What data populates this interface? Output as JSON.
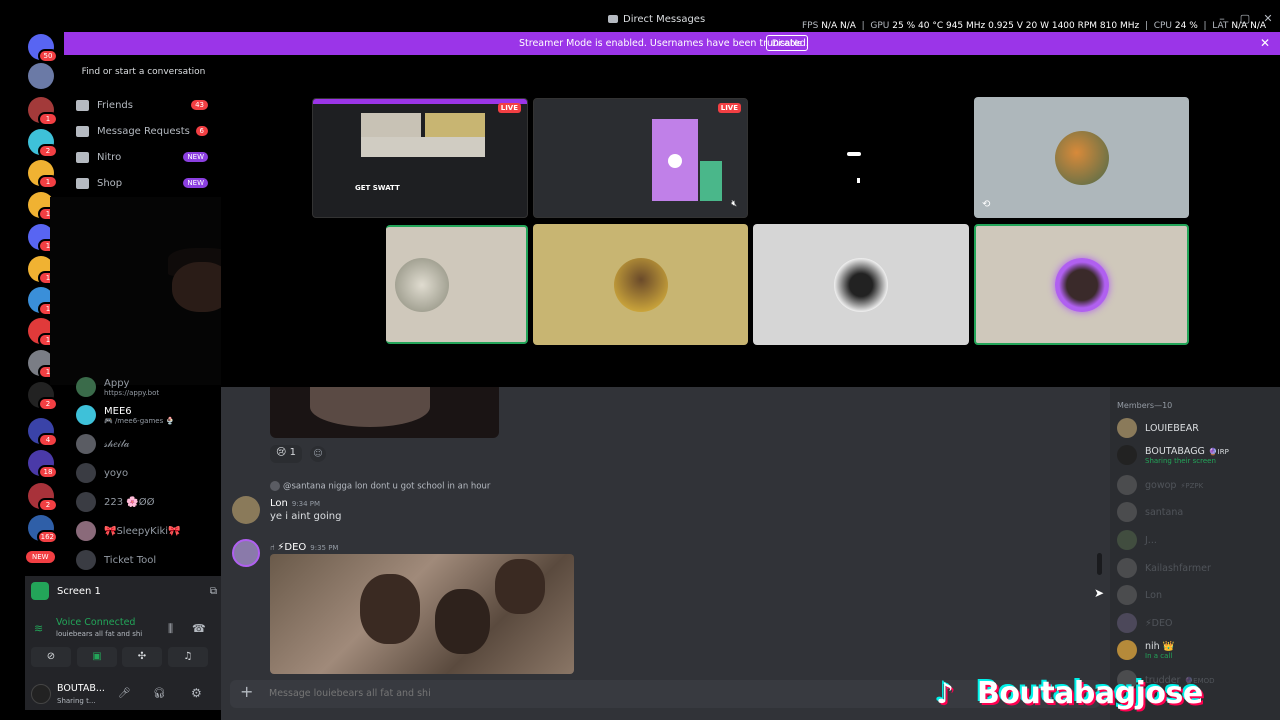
{
  "window": {
    "title": "Direct Messages",
    "stats": {
      "fps_label": "FPS",
      "fps_value": "N/A",
      "fps_value2": "N/A",
      "gpu_label": "GPU",
      "gpu_value": "25 % 40 °C 945 MHz 0.925 V 20 W 1400 RPM 810 MHz",
      "cpu_label": "CPU",
      "cpu_value": "24 %",
      "lat_label": "LAT",
      "lat_value": "N/A",
      "lat_value2": "N/A"
    }
  },
  "banner": {
    "text": "Streamer Mode is enabled. Usernames have been truncated.",
    "button": "Disable",
    "close": "✕"
  },
  "servers": [
    {
      "badge": "50",
      "color": "#5865f2"
    },
    {
      "badge": "",
      "color": "#6b7aa6"
    },
    {
      "badge": "1",
      "color": "#a33a3a"
    },
    {
      "badge": "2",
      "color": "#3ec1d9"
    },
    {
      "badge": "1",
      "color": "#f0b232"
    },
    {
      "badge": "1",
      "color": "#f0b232"
    },
    {
      "badge": "1",
      "color": "#5865f2"
    },
    {
      "badge": "1",
      "color": "#f0b232"
    },
    {
      "badge": "1",
      "color": "#3a8fd9"
    },
    {
      "badge": "1",
      "color": "#e03a3a"
    },
    {
      "badge": "1",
      "color": "#7a7d85"
    },
    {
      "badge": "2",
      "color": "#222222"
    },
    {
      "badge": "4",
      "color": "#3a43a8"
    },
    {
      "badge": "18",
      "color": "#4a3aa8"
    },
    {
      "badge": "2",
      "color": "#a8323a"
    },
    {
      "badge": "162",
      "color": "#2f5fa8"
    }
  ],
  "new_pill": "NEW",
  "sidebar": {
    "find": "Find or start a conversation",
    "nav": [
      {
        "label": "Friends",
        "pill": "43"
      },
      {
        "label": "Message Requests",
        "pill": "6"
      },
      {
        "label": "Nitro",
        "pill": "NEW"
      },
      {
        "label": "Shop",
        "pill": "NEW"
      }
    ],
    "dms": [
      {
        "name": "Appy",
        "sub": "https://appy.bot",
        "color": "#3a6b4a"
      },
      {
        "name": "MEE6",
        "sub": "🎮 /mee6-games 🍨",
        "color": "#3ec1d9"
      },
      {
        "name": "𝓈𝒽𝑒𝒾𝓁𝒶",
        "sub": "",
        "color": "#5a5c63"
      },
      {
        "name": "yoyo",
        "sub": "",
        "color": "#4a4c53"
      },
      {
        "name": "223 🌸ØØ",
        "sub": "",
        "color": "#4a4c53"
      },
      {
        "name": "🎀SleepyKiki🎀",
        "sub": "",
        "color": "#8a6a7a"
      },
      {
        "name": "Ticket Tool",
        "sub": "",
        "color": "#3a3c43"
      }
    ]
  },
  "voice": {
    "screen_label": "Screen 1",
    "status": "Voice Connected",
    "channel": "louiebears all fat and shi",
    "user": "BOUTAB...",
    "user_status": "Sharing t..."
  },
  "stage": {
    "live": "LIVE",
    "stream_caption": "GET SWATT",
    "tiles_row2_colors": [
      "#cfc8bb",
      "#c8b572",
      "#d6d6d6",
      "#cfc8bb"
    ],
    "top_right_color": "#aeb7bb"
  },
  "chat": {
    "reaction_count": "1",
    "reply_ref": "@santana nigga lon dont u got school in an hour",
    "messages": [
      {
        "author": "Lon",
        "time": "9:34 PM",
        "text": "ye i aint going"
      },
      {
        "author": "⚡DEO",
        "time": "9:35 PM",
        "text": ""
      }
    ],
    "placeholder": "Message louiebears all fat and shi"
  },
  "members": {
    "header": "Members—10",
    "list": [
      {
        "name": "LOUIEBEAR",
        "status": "",
        "dim": false,
        "color": "#8a7a5a"
      },
      {
        "name": "BOUTABAGG",
        "tag": "🔮IRP",
        "status": "Sharing their screen",
        "dim": false,
        "color": "#222"
      },
      {
        "name": "gowop",
        "tag": "⚡PZPK",
        "status": "",
        "dim": true,
        "color": "#888"
      },
      {
        "name": "santana",
        "status": "",
        "dim": true,
        "color": "#888"
      },
      {
        "name": "J...",
        "status": "",
        "dim": true,
        "color": "#6a8a5a"
      },
      {
        "name": "Kailashfarmer",
        "status": "",
        "dim": true,
        "color": "#888"
      },
      {
        "name": "Lon",
        "status": "",
        "dim": true,
        "color": "#888"
      },
      {
        "name": "⚡DEO",
        "status": "",
        "dim": true,
        "color": "#8a7aaa"
      },
      {
        "name": "nih 👑",
        "status": "In a call",
        "dim": false,
        "color": "#b58a3a"
      },
      {
        "name": "trudder",
        "tag": "🔮EMOD",
        "status": "",
        "dim": true,
        "color": "#888"
      }
    ]
  },
  "watermark": "Boutabagjose"
}
